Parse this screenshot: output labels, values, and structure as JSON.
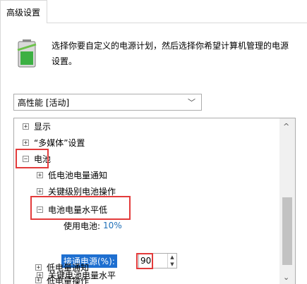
{
  "dialog": {
    "tab_label": "高级设置",
    "description": "选择你要自定义的电源计划，然后选择你希望计算机管理的电源设置。"
  },
  "plan_select": {
    "value": "高性能 [活动]",
    "chevron": "﹀"
  },
  "tree": {
    "display": {
      "expander": "+",
      "label": "显示"
    },
    "multimedia": {
      "expander": "+",
      "label": "“多媒体”设置"
    },
    "battery": {
      "expander": "−",
      "label": "电池"
    },
    "low_notify": {
      "expander": "+",
      "label": "低电池电量通知"
    },
    "critical_action": {
      "expander": "+",
      "label": "关键级别电池操作"
    },
    "level": {
      "expander": "−",
      "label": "电池电量水平低"
    },
    "on_battery": {
      "label": "使用电池:",
      "value": "10%"
    },
    "plugged_in": {
      "label": "接通电源(%):",
      "value": "90"
    },
    "critical_level": {
      "expander": "+",
      "label": "关键电池电量水平"
    },
    "low_level_notify": {
      "expander": "+",
      "label": "低电量通知"
    },
    "low_action": {
      "expander": "+",
      "label": "低电量操作"
    }
  },
  "scrollbar": {
    "up": "^",
    "down": "⌄"
  },
  "spinner": {
    "up": "▲",
    "down": "▼"
  },
  "colors": {
    "highlight_box": "#e33b3b",
    "selection": "#1e6fd0",
    "value_text": "#1e6fb8"
  }
}
